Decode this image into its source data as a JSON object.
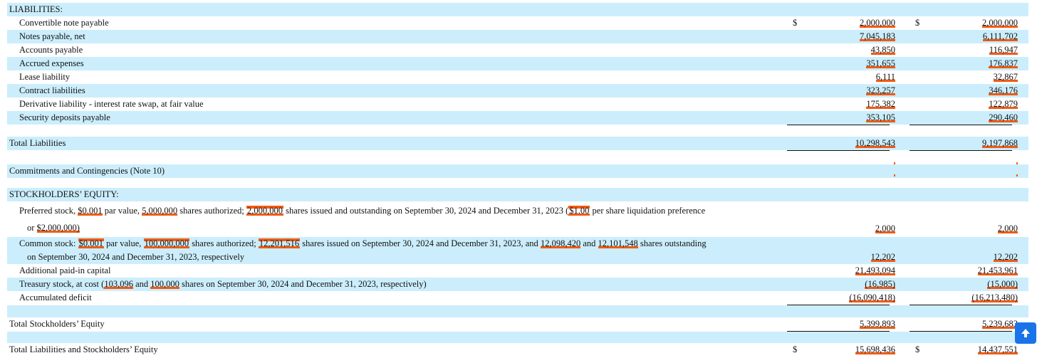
{
  "liabilities": {
    "heading": "LIABILITIES:",
    "currency_symbol": "$",
    "rows": [
      {
        "label": "Convertible note payable",
        "v2024": "2,000,000",
        "v2023": "2,000,000"
      },
      {
        "label": "Notes payable, net",
        "v2024": "7,045,183",
        "v2023": "6,111,702"
      },
      {
        "label": "Accounts payable",
        "v2024": "43,850",
        "v2023": "116,947"
      },
      {
        "label": "Accrued expenses",
        "v2024": "351,655",
        "v2023": "176,837"
      },
      {
        "label": "Lease liability",
        "v2024": "6,111",
        "v2023": "32,867"
      },
      {
        "label": "Contract liabilities",
        "v2024": "323,257",
        "v2023": "346,176"
      },
      {
        "label": "Derivative liability - interest rate swap, at fair value",
        "v2024": "175,382",
        "v2023": "122,879"
      },
      {
        "label": "Security deposits payable",
        "v2024": "353,105",
        "v2023": "290,460"
      }
    ],
    "total": {
      "label": "Total Liabilities",
      "v2024": "10,298,543",
      "v2023": "9,197,868"
    }
  },
  "commitments": {
    "label": "Commitments and Contingencies (Note 10)"
  },
  "equity": {
    "heading": "STOCKHOLDERS’ EQUITY:",
    "preferred": {
      "t1": "Preferred stock, ",
      "h1": "$0.001",
      "t2": " par value, ",
      "h2": "5,000,000",
      "t3": " shares authorized; ",
      "h3": "2,000,000",
      "t4": " shares issued and outstanding on September 30, 2024 and December 31, 2023 (",
      "h4": "$1.00",
      "t5": " per share liquidation preference",
      "t6": "or ",
      "h5": "$2,000,000)",
      "v2024": "2,000",
      "v2023": "2,000"
    },
    "common": {
      "t1": "Common stock: ",
      "h1": "$0.001",
      "t2": " par value, ",
      "h2": "100,000,000",
      "t3": " shares authorized; ",
      "h3": "12,201,516",
      "t4": " shares issued on September 30, 2024 and December 31, 2023, and ",
      "h4": "12,098,420",
      "t5": " and ",
      "h5": "12,101,548",
      "t6": " shares outstanding",
      "t7": "on September 30, 2024 and December 31, 2023, respectively",
      "v2024": "12,202",
      "v2023": "12,202"
    },
    "apic": {
      "label": "Additional paid-in capital",
      "v2024": "21,493,094",
      "v2023": "21,453,961"
    },
    "treasury": {
      "t1": "Treasury stock, at cost (",
      "h1": "103,096",
      "t2": " and ",
      "h2": "100,000",
      "t3": " shares on September 30, 2024 and December 31, 2023, respectively)",
      "v2024": "(16,985)",
      "v2023": "(15,000)"
    },
    "deficit": {
      "label": "Accumulated deficit",
      "v2024": "(16,090,418)",
      "v2023": "(16,213,480)"
    },
    "total": {
      "label": "Total Stockholders’ Equity",
      "v2024": "5,399,893",
      "v2023": "5,239,683"
    }
  },
  "grand_total": {
    "label": "Total Liabilities and Stockholders’ Equity",
    "v2024": "15,698,436",
    "v2023": "14,437,551"
  },
  "highlight_color": "#f15a12",
  "row_band_color": "#cceefc",
  "scroll_button": {
    "icon": "arrow-up-icon",
    "glyph": "🡅"
  }
}
